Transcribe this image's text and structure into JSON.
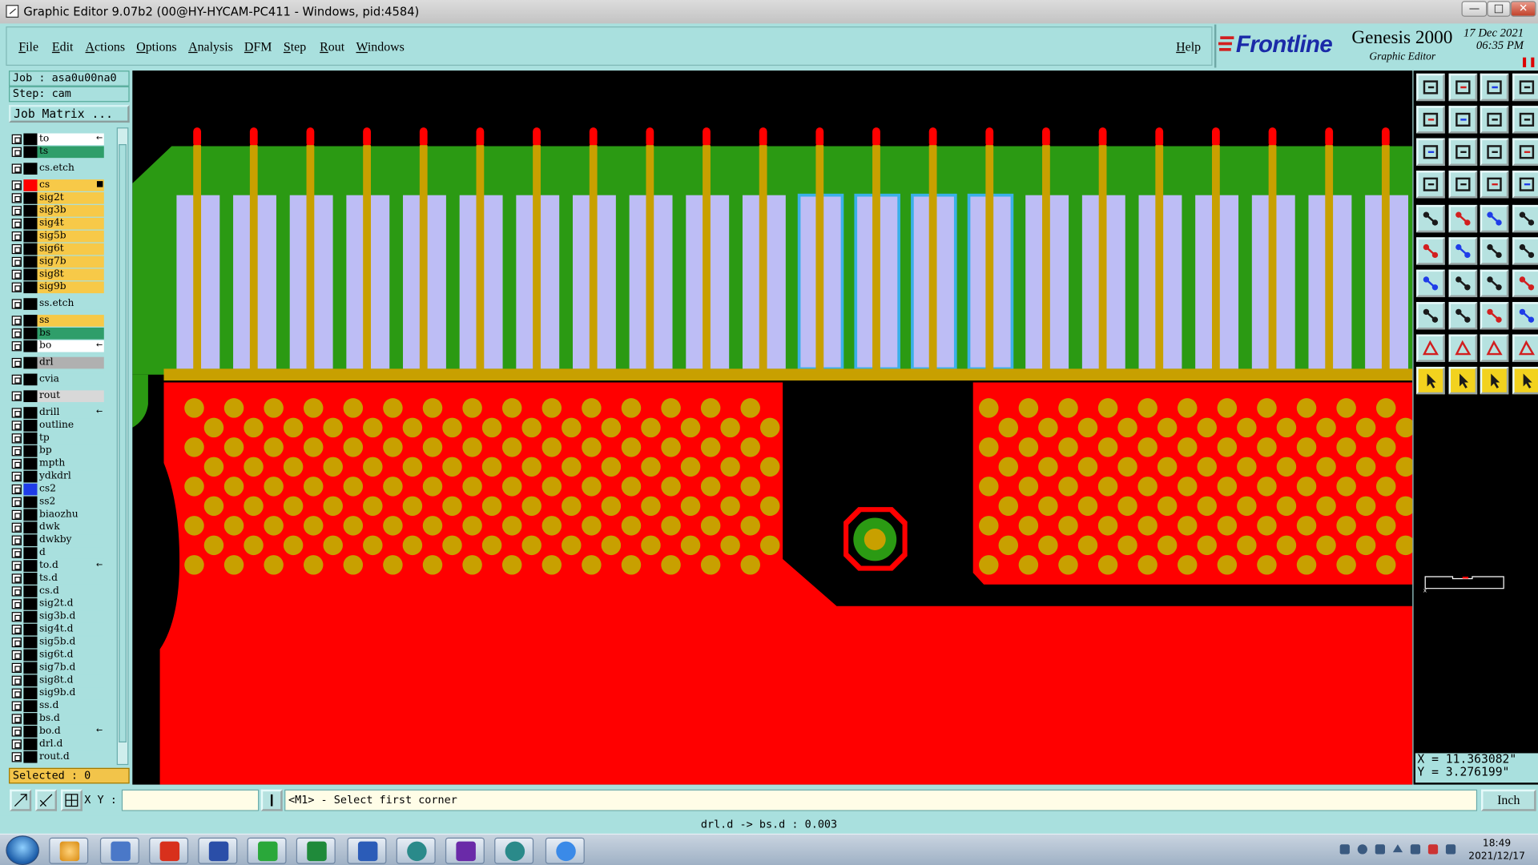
{
  "window": {
    "title": "Graphic Editor 9.07b2 (00@HY-HYCAM-PC411 - Windows, pid:4584)",
    "buttons": [
      "—",
      "□",
      "✕"
    ]
  },
  "menu": [
    "File",
    "Edit",
    "Actions",
    "Options",
    "Analysis",
    "DFM",
    "Step",
    "Rout",
    "Windows"
  ],
  "help": "Help",
  "brand": {
    "logo": "Frontline",
    "product": "Genesis 2000",
    "subtitle": "Graphic Editor",
    "date_line1": "17 Dec 2021",
    "date_line2": "06:35 PM"
  },
  "job": {
    "job_label": "Job : asa0u00na0",
    "step_label": "Step: cam",
    "matrix_button": "Job Matrix ..."
  },
  "layers": [
    {
      "name": "to",
      "color": "#ffffff",
      "flag": "←"
    },
    {
      "name": "ts",
      "color": "#2f9e6a"
    },
    {
      "name": "cs.etch",
      "color": "#a9e0de"
    },
    {
      "name": "cs",
      "color": "#f7c948",
      "swatch": "#ff0000",
      "active": true,
      "flag": "■"
    },
    {
      "name": "sig2t",
      "color": "#f7c948"
    },
    {
      "name": "sig3b",
      "color": "#f7c948"
    },
    {
      "name": "sig4t",
      "color": "#f7c948"
    },
    {
      "name": "sig5b",
      "color": "#f7c948"
    },
    {
      "name": "sig6t",
      "color": "#f7c948"
    },
    {
      "name": "sig7b",
      "color": "#f7c948"
    },
    {
      "name": "sig8t",
      "color": "#f7c948"
    },
    {
      "name": "sig9b",
      "color": "#f7c948"
    },
    {
      "name": "ss.etch",
      "color": "#a9e0de"
    },
    {
      "name": "ss",
      "color": "#f7c948"
    },
    {
      "name": "bs",
      "color": "#2f9e6a"
    },
    {
      "name": "bo",
      "color": "#ffffff",
      "flag": "←"
    },
    {
      "name": "drl",
      "color": "#b0b0b0"
    },
    {
      "name": "cvia",
      "color": "#a9e0de"
    },
    {
      "name": "rout",
      "color": "#d8d8d8"
    },
    {
      "name": "drill",
      "color": "#a9e0de",
      "flag": "←"
    },
    {
      "name": "outline",
      "color": "#a9e0de"
    },
    {
      "name": "tp",
      "color": "#a9e0de"
    },
    {
      "name": "bp",
      "color": "#a9e0de"
    },
    {
      "name": "mpth",
      "color": "#a9e0de"
    },
    {
      "name": "ydkdrl",
      "color": "#a9e0de"
    },
    {
      "name": "cs2",
      "color": "#a9e0de",
      "swatch": "#1f3de8"
    },
    {
      "name": "ss2",
      "color": "#a9e0de"
    },
    {
      "name": "biaozhu",
      "color": "#a9e0de"
    },
    {
      "name": "dwk",
      "color": "#a9e0de"
    },
    {
      "name": "dwkby",
      "color": "#a9e0de"
    },
    {
      "name": "d",
      "color": "#a9e0de"
    },
    {
      "name": "to.d",
      "color": "#a9e0de",
      "flag": "←"
    },
    {
      "name": "ts.d",
      "color": "#a9e0de"
    },
    {
      "name": "cs.d",
      "color": "#a9e0de"
    },
    {
      "name": "sig2t.d",
      "color": "#a9e0de"
    },
    {
      "name": "sig3b.d",
      "color": "#a9e0de"
    },
    {
      "name": "sig4t.d",
      "color": "#a9e0de"
    },
    {
      "name": "sig5b.d",
      "color": "#a9e0de"
    },
    {
      "name": "sig6t.d",
      "color": "#a9e0de"
    },
    {
      "name": "sig7b.d",
      "color": "#a9e0de"
    },
    {
      "name": "sig8t.d",
      "color": "#a9e0de"
    },
    {
      "name": "sig9b.d",
      "color": "#a9e0de"
    },
    {
      "name": "ss.d",
      "color": "#a9e0de"
    },
    {
      "name": "bs.d",
      "color": "#a9e0de"
    },
    {
      "name": "bo.d",
      "color": "#a9e0de",
      "flag": "←"
    },
    {
      "name": "drl.d",
      "color": "#a9e0de"
    },
    {
      "name": "rout.d",
      "color": "#a9e0de"
    }
  ],
  "selected_label": "Selected : 0",
  "coords": {
    "x": "X = 11.363082\"",
    "y": "Y = 3.276199\""
  },
  "xy_label": "X Y :",
  "xy_value": "",
  "message": "<M1> - Select first corner",
  "unit": "Inch",
  "status": "drl.d -> bs.d : 0.003",
  "clock": {
    "time": "18:49",
    "date": "2021/12/17"
  },
  "colors": {
    "board_red": "#ff0000",
    "mask_green": "#2b9a13",
    "slot_lavender": "#bdbdf5",
    "pad_gold": "#c8a000",
    "ui_cyan": "#a9e0de"
  },
  "toolbar_icons": [
    "export-icon",
    "import-icon",
    "home-icon",
    "snap-icon",
    "step-left-icon",
    "step-right-icon",
    "flip-icon",
    "s-curve-icon",
    "zoom-fit-icon",
    "zoom-center-icon",
    "one-to-one-icon",
    "help-icon",
    "measure-icon",
    "grid-icon",
    "net-icon",
    "net2-icon",
    "pad-icon",
    "square-pad-icon",
    "line-icon",
    "circle-icon",
    "points-icon",
    "cross-icon",
    "node-icon",
    "x-icon",
    "draw-line-icon",
    "draw-slope-icon",
    "arc-icon",
    "fill-icon",
    "pad-edit-icon",
    "line-edit-icon",
    "dim-icon",
    "group-icon",
    "triangle-icon",
    "triangle2-icon",
    "triangle3-icon",
    "triangle4-icon",
    "select-arrow-icon",
    "select-arrow2-icon",
    "select-arrow3-icon",
    "route-icon"
  ]
}
